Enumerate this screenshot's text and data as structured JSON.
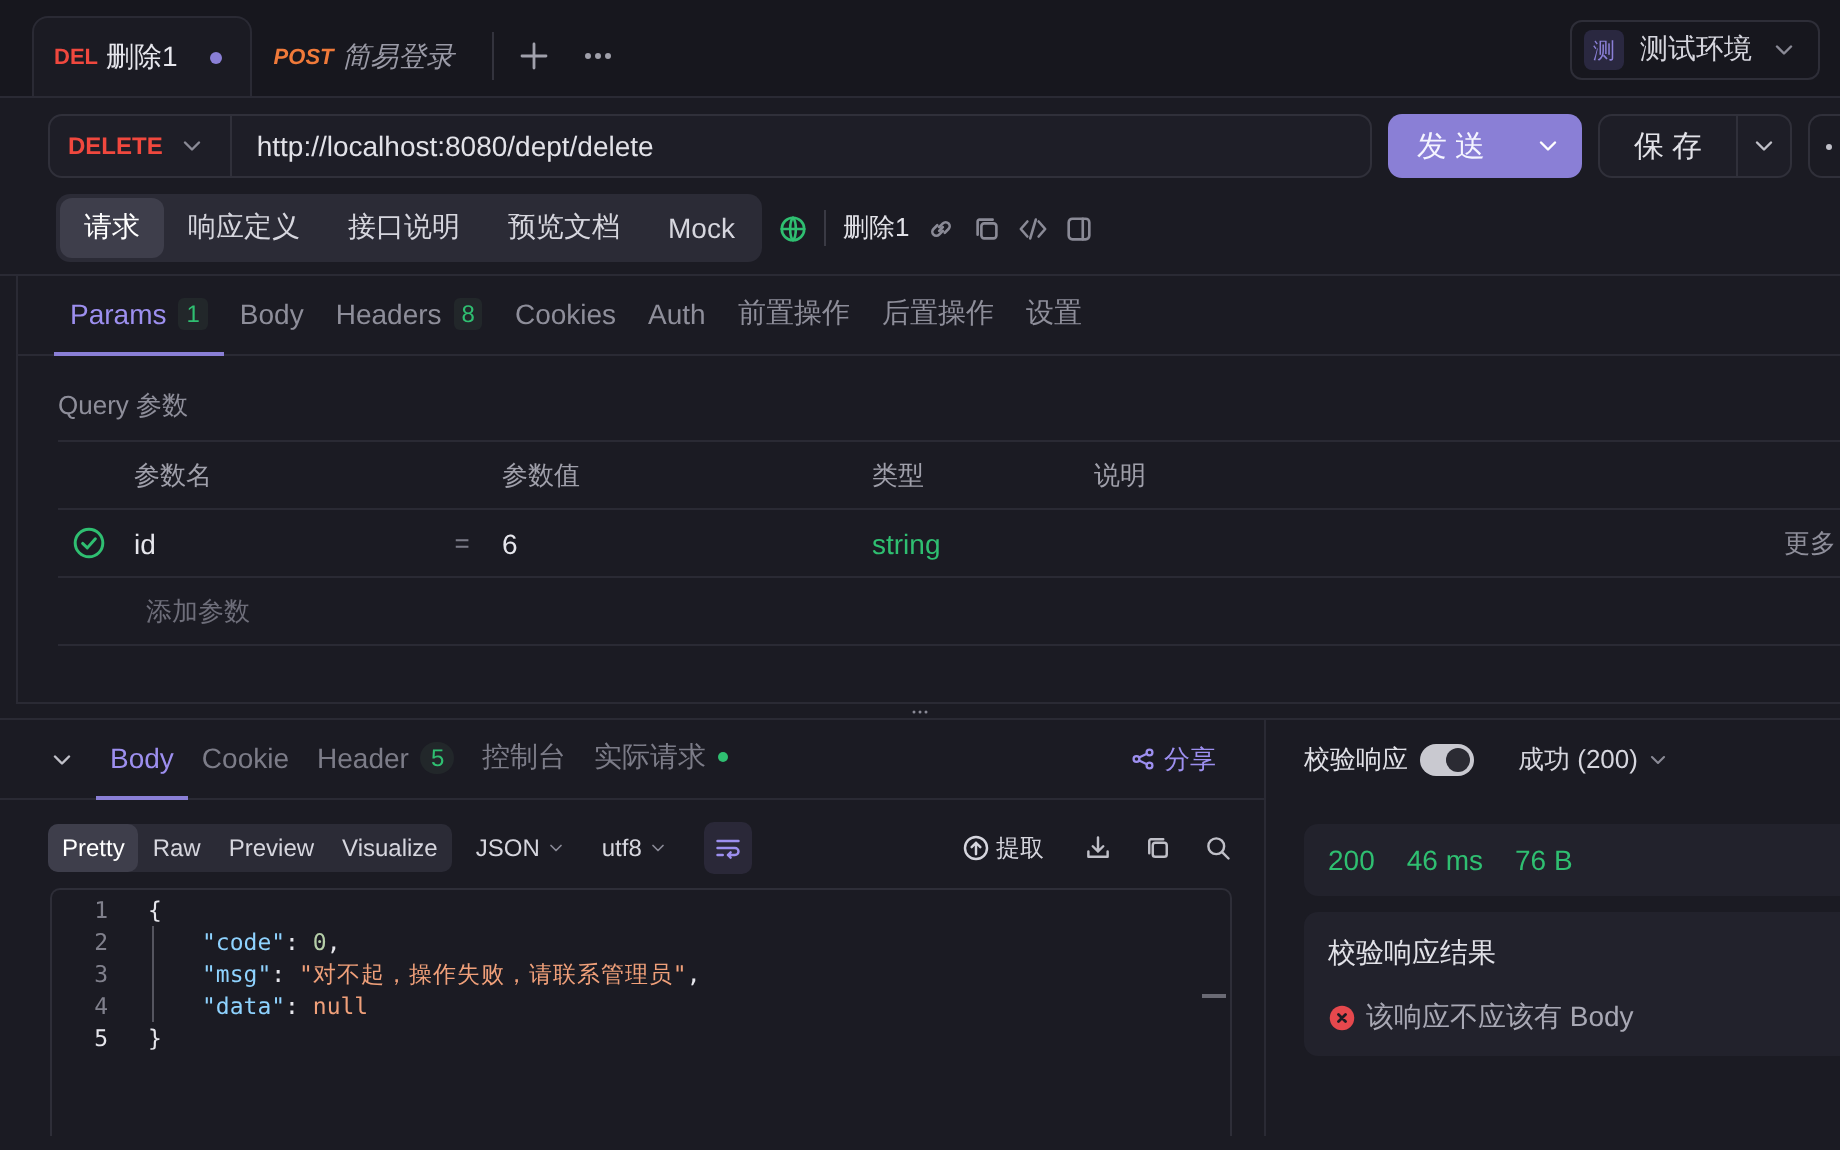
{
  "request_tabs": [
    {
      "method": "DEL",
      "color": "#f0483e",
      "title": "删除1",
      "selected": true,
      "unsaved": true,
      "preview": false
    },
    {
      "method": "POST",
      "color": "#f07a3a",
      "title": "简易登录",
      "selected": false,
      "unsaved": false,
      "preview": true
    }
  ],
  "environment": {
    "badge": "测",
    "name": "测试环境"
  },
  "request": {
    "method": "DELETE",
    "url": "http://localhost:8080/dept/delete",
    "send": "发 送",
    "save": "保 存"
  },
  "view_tabs": [
    {
      "label": "请求",
      "selected": true
    },
    {
      "label": "响应定义",
      "selected": false
    },
    {
      "label": "接口说明",
      "selected": false
    },
    {
      "label": "预览文档",
      "selected": false
    },
    {
      "label": "Mock",
      "selected": false
    }
  ],
  "api_name": "删除1",
  "param_tabs": [
    {
      "label": "Params",
      "count": "1",
      "selected": true
    },
    {
      "label": "Body",
      "selected": false
    },
    {
      "label": "Headers",
      "count": "8",
      "selected": false
    },
    {
      "label": "Cookies",
      "selected": false
    },
    {
      "label": "Auth",
      "selected": false
    },
    {
      "label": "前置操作",
      "selected": false
    },
    {
      "label": "后置操作",
      "selected": false
    },
    {
      "label": "设置",
      "selected": false
    }
  ],
  "query": {
    "title": "Query 参数",
    "columns": [
      "参数名",
      "参数值",
      "类型",
      "说明"
    ],
    "rows": [
      {
        "checked": true,
        "name": "id",
        "operator": "=",
        "value": "6",
        "type": "string",
        "more": "更多"
      }
    ],
    "add_placeholder": "添加参数"
  },
  "response": {
    "tabs": [
      {
        "label": "Body",
        "selected": true
      },
      {
        "label": "Cookie",
        "selected": false
      },
      {
        "label": "Header",
        "count": "5",
        "selected": false
      },
      {
        "label": "控制台",
        "selected": false
      },
      {
        "label": "实际请求",
        "selected": false,
        "dot": true
      }
    ],
    "share": "分享",
    "formats": [
      {
        "label": "Pretty",
        "selected": true
      },
      {
        "label": "Raw",
        "selected": false
      },
      {
        "label": "Preview",
        "selected": false
      },
      {
        "label": "Visualize",
        "selected": false
      }
    ],
    "language": "JSON",
    "encoding": "utf8",
    "extract": "提取",
    "lines": [
      {
        "number": "1",
        "indent": false,
        "tokens": [
          {
            "kind": "punct",
            "text": "{"
          }
        ]
      },
      {
        "number": "2",
        "indent": true,
        "tokens": [
          {
            "kind": "key",
            "text": "\"code\""
          },
          {
            "kind": "punct",
            "text": ": "
          },
          {
            "kind": "number",
            "text": "0"
          },
          {
            "kind": "punct",
            "text": ","
          }
        ]
      },
      {
        "number": "3",
        "indent": true,
        "tokens": [
          {
            "kind": "key",
            "text": "\"msg\""
          },
          {
            "kind": "punct",
            "text": ": "
          },
          {
            "kind": "string",
            "text": "\"对不起，操作失败，请联系管理员\""
          },
          {
            "kind": "punct",
            "text": ","
          }
        ]
      },
      {
        "number": "4",
        "indent": true,
        "tokens": [
          {
            "kind": "key",
            "text": "\"data\""
          },
          {
            "kind": "punct",
            "text": ": "
          },
          {
            "kind": "null",
            "text": "null"
          }
        ]
      },
      {
        "number": "5",
        "indent": false,
        "tokens": [
          {
            "kind": "punct",
            "text": "}"
          }
        ]
      }
    ]
  },
  "assertion": {
    "label": "校验响应",
    "on": true,
    "status": "成功 (200)",
    "metrics": [
      "200",
      "46 ms",
      "76 B"
    ],
    "result_title": "校验响应结果",
    "results": [
      {
        "passed": false,
        "text": "该响应不应该有 Body"
      }
    ]
  }
}
